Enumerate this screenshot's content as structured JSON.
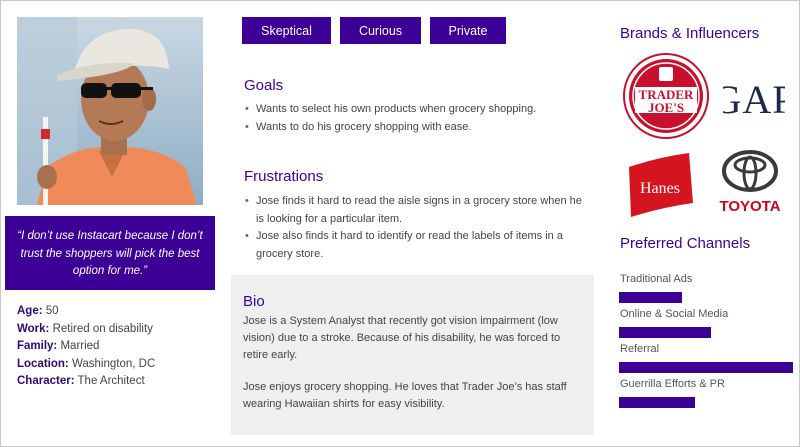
{
  "persona": {
    "quote": "“I don’t use Instacart because I don’t trust the shoppers will pick the best option for me.”",
    "profile": [
      {
        "key": "Age:",
        "value": "50"
      },
      {
        "key": "Work:",
        "value": "Retired on disability"
      },
      {
        "key": "Family:",
        "value": "Married"
      },
      {
        "key": "Location:",
        "value": "Washington, DC"
      },
      {
        "key": "Character:",
        "value": "The Architect"
      }
    ]
  },
  "traits": [
    "Skeptical",
    "Curious",
    "Private"
  ],
  "goals": {
    "title": "Goals",
    "items": [
      "Wants to select his own products when grocery shopping.",
      "Wants to do his grocery shopping with ease."
    ]
  },
  "frustrations": {
    "title": "Frustrations",
    "items": [
      "Jose finds it hard to read the aisle signs in a grocery store when he is looking for a particular item.",
      "Jose also finds it hard to identify or read the labels of items in a grocery store."
    ]
  },
  "bio": {
    "title": "Bio",
    "paragraphs": [
      "Jose is a System Analyst that recently got vision impairment (low vision) due to a stroke. Because of his disability, he was forced to retire early.",
      "Jose enjoys grocery shopping. He loves that Trader Joe’s has staff wearing Hawaiian shirts for easy visibility."
    ]
  },
  "brands": {
    "title": "Brands & Influencers",
    "trader_joes": {
      "line1": "TRADER",
      "line2": "JOE'S"
    },
    "gap": "GAP",
    "hanes": "Hanes",
    "toyota": "TOYOTA"
  },
  "channels": {
    "title": "Preferred Channels",
    "items": [
      {
        "label": "Traditional Ads",
        "level": 0.36
      },
      {
        "label": "Online & Social Media",
        "level": 0.52
      },
      {
        "label": "Referral",
        "level": 0.99
      },
      {
        "label": "Guerrilla Efforts & PR",
        "level": 0.43
      }
    ]
  },
  "colors": {
    "accent": "#3c0097",
    "trader_joes_red": "#c8102e",
    "hanes_red": "#d4141e",
    "toyota_red": "#d6001c",
    "bio_background": "#efefef"
  }
}
